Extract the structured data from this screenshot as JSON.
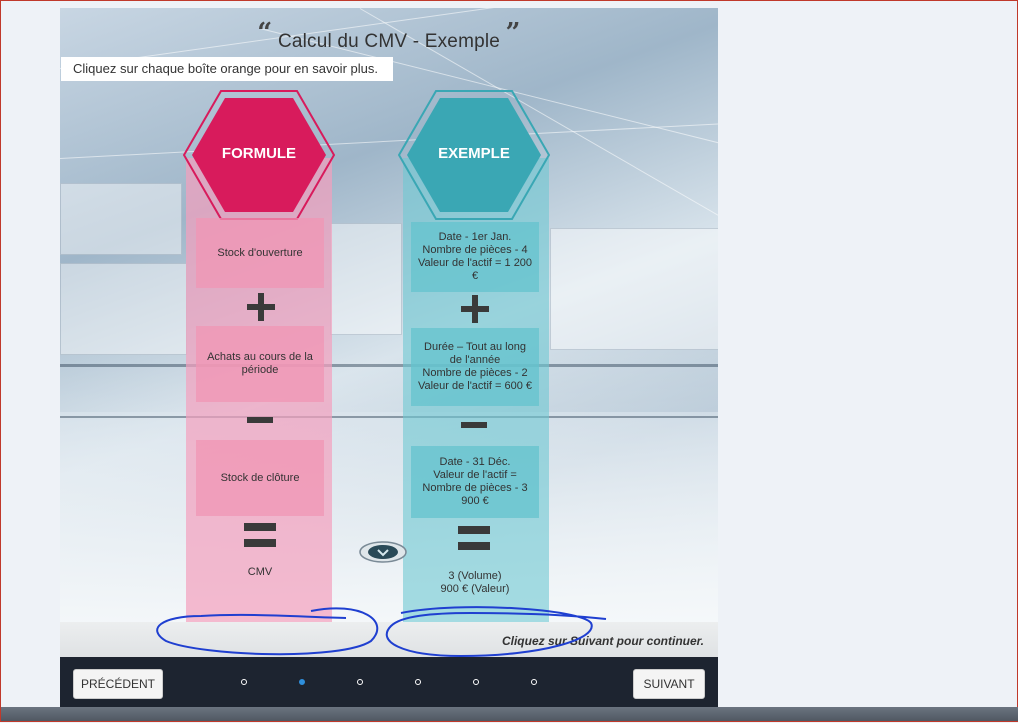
{
  "slide": {
    "title": "Calcul du CMV - Exemple",
    "instruction": "Cliquez sur chaque boîte orange pour en savoir plus."
  },
  "formule": {
    "header": "FORMULE",
    "items": [
      "Stock d'ouverture",
      "Achats au cours de la période",
      "Stock de clôture"
    ],
    "result": "CMV"
  },
  "exemple": {
    "header": "EXEMPLE",
    "items": [
      [
        "Date - 1er Jan.",
        "Nombre de pièces - 4",
        "Valeur de l'actif = 1 200 €"
      ],
      [
        "Durée – Tout au long de l'année",
        "Nombre de pièces - 2",
        "Valeur de l'actif = 600 €"
      ],
      [
        "Date - 31 Déc.",
        "Valeur de l'actif =",
        "Nombre de pièces - 3",
        "900 €"
      ]
    ],
    "result": [
      "3 (Volume)",
      "900 € (Valeur)"
    ]
  },
  "footer": {
    "continue_hint": "Cliquez sur Suivant pour continuer."
  },
  "nav": {
    "prev_label": "PRÉCÉDENT",
    "next_label": "SUIVANT",
    "page_count": 6,
    "active_page": 2
  },
  "colors": {
    "formule_accent": "#d81b5c",
    "exemple_accent": "#3aa7b4",
    "nav_bg": "#1d2430",
    "active_dot": "#2f8fdc",
    "annotation": "#1f3fd0"
  }
}
